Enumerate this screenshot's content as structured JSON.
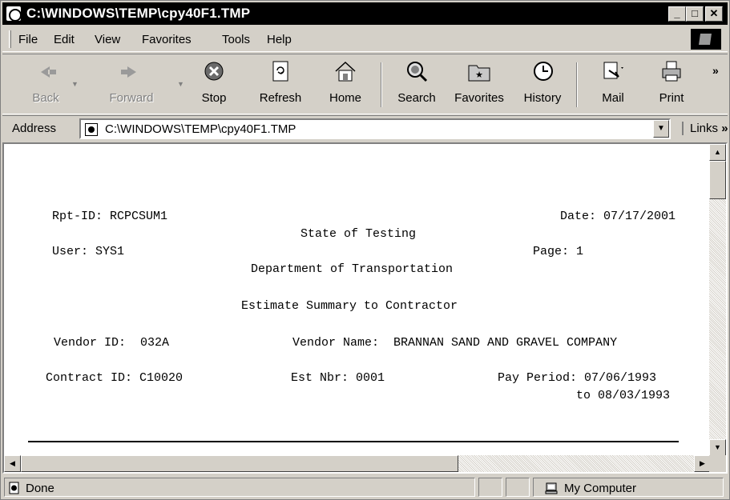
{
  "window": {
    "title": "C:\\WINDOWS\\TEMP\\cpy40F1.TMP",
    "controls": {
      "minimize": "_",
      "maximize": "□",
      "close": "✕"
    }
  },
  "menu": {
    "file": "File",
    "edit": "Edit",
    "view": "View",
    "favorites": "Favorites",
    "tools": "Tools",
    "help": "Help"
  },
  "toolbar": {
    "back": "Back",
    "forward": "Forward",
    "stop": "Stop",
    "refresh": "Refresh",
    "home": "Home",
    "search": "Search",
    "favorites": "Favorites",
    "history": "History",
    "mail": "Mail",
    "print": "Print",
    "more": "»"
  },
  "address": {
    "label": "Address",
    "value": "C:\\WINDOWS\\TEMP\\cpy40F1.TMP",
    "links_label": "Links",
    "links_more": "»"
  },
  "report": {
    "rpt_id": "Rpt-ID: RCPCSUM1",
    "date": "Date: 07/17/2001",
    "state": "State of Testing",
    "user": "User: SYS1",
    "page": "Page: 1",
    "department": "Department of Transportation",
    "report_title": "Estimate Summary to Contractor",
    "vendor_id": "Vendor ID:  032A",
    "vendor_name": "Vendor Name:  BRANNAN SAND AND GRAVEL COMPANY",
    "contract_id": "Contract ID: C10020",
    "est_nbr": "Est Nbr: 0001",
    "pay_period": "Pay Period: 07/06/1993",
    "pay_period_to": "to 08/03/1993"
  },
  "statusbar": {
    "status": "Done",
    "zone": "My Computer"
  }
}
